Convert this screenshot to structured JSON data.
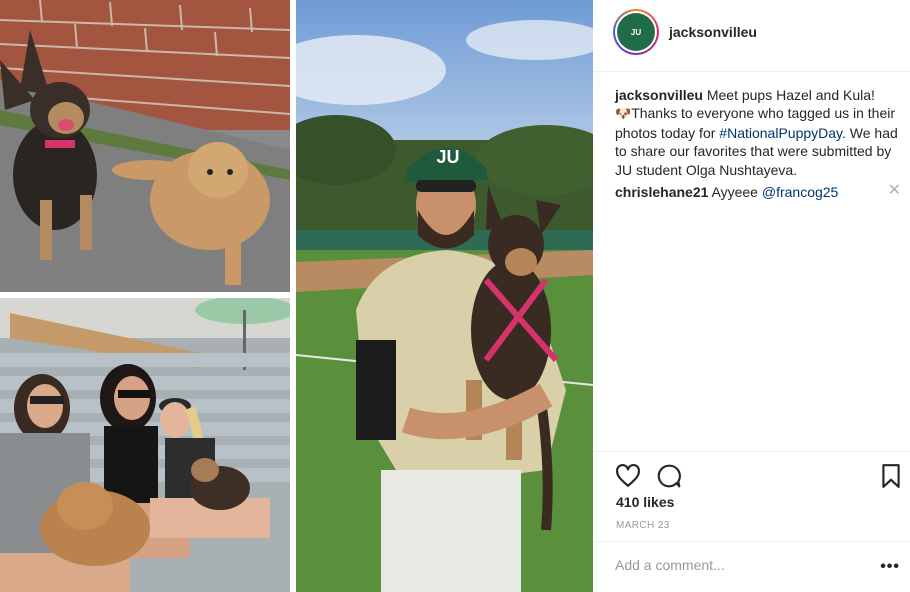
{
  "post": {
    "username": "jacksonvilleu",
    "avatar_text": "JU",
    "caption": {
      "username": "jacksonvilleu",
      "text_1": "Meet pups Hazel and Kula!",
      "emoji": "🐶",
      "text_2": "Thanks to everyone who tagged us in their photos today for",
      "hashtag": "#NationalPuppyDay",
      "text_3": ". We had to share our favorites that were submitted by JU student Olga Nushtayeva."
    },
    "comments": [
      {
        "username": "chrislehane21",
        "text": "Ayyeee",
        "mention": "@francog25",
        "close": "✕"
      }
    ],
    "likes": "410 likes",
    "date": "MARCH 23",
    "add_comment_placeholder": "Add a comment...",
    "more_label": "•••"
  },
  "photos": {
    "jersey_text": "JU",
    "cap_text": "JU"
  },
  "colors": {
    "link": "#003569",
    "text": "#262626",
    "muted": "#999999",
    "border": "#efefef"
  }
}
